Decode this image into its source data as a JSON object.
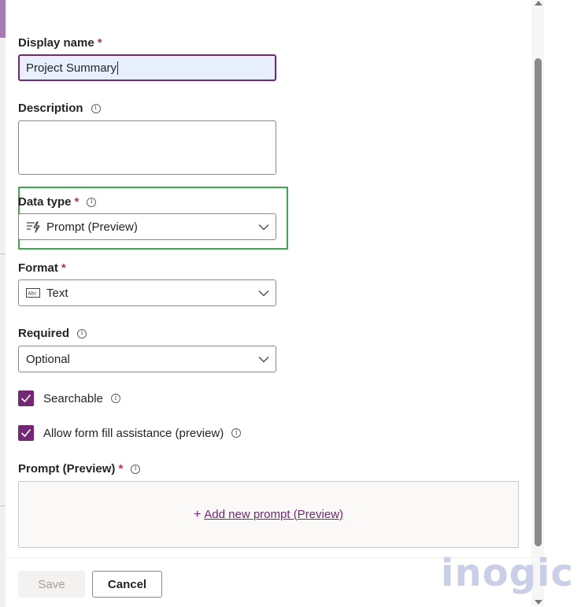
{
  "form": {
    "display_name": {
      "label": "Display name",
      "required": "*",
      "value": "Project Summary"
    },
    "description": {
      "label": "Description",
      "value": ""
    },
    "data_type": {
      "label": "Data type",
      "required": "*",
      "value": "Prompt (Preview)"
    },
    "format": {
      "label": "Format",
      "required": "*",
      "value": "Text"
    },
    "required_field": {
      "label": "Required",
      "value": "Optional"
    },
    "searchable": {
      "label": "Searchable",
      "checked": true
    },
    "form_fill": {
      "label": "Allow form fill assistance (preview)",
      "checked": true
    },
    "prompt": {
      "label": "Prompt (Preview)",
      "required": "*",
      "add_link": "Add new prompt (Preview)",
      "plus": "+"
    }
  },
  "footer": {
    "save_label": "Save",
    "cancel_label": "Cancel"
  },
  "icons": {
    "info": "info-circle-icon",
    "chevron": "chevron-down-icon",
    "prompt": "prompt-icon",
    "text_format": "text-format-icon",
    "check": "checkmark-icon"
  },
  "colors": {
    "accent": "#742774",
    "highlight": "#3aaa4d",
    "required": "#c4314b"
  }
}
